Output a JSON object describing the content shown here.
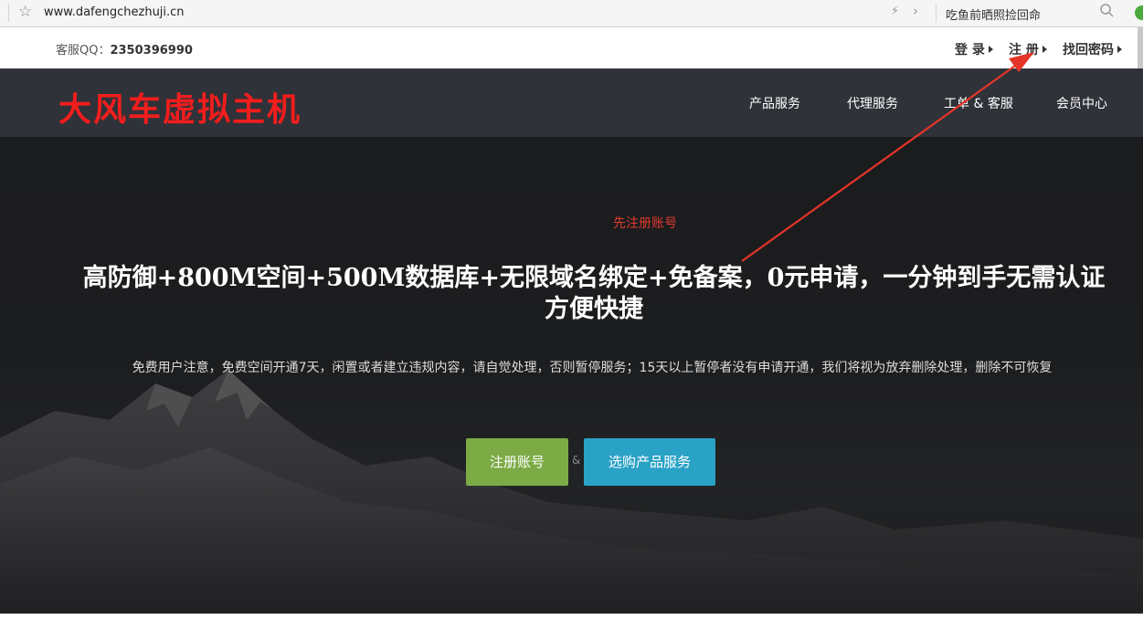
{
  "browser": {
    "url": "www.dafengchezhuji.cn",
    "search_text": "吃鱼前晒照捡回命"
  },
  "topbar": {
    "qq_label": "客服QQ：",
    "qq_number": "2350396990",
    "links": [
      {
        "label": "登 录"
      },
      {
        "label": "注 册"
      },
      {
        "label": "找回密码"
      }
    ]
  },
  "nav": {
    "logo": "大风车虚拟主机",
    "items": [
      {
        "label": "产品服务"
      },
      {
        "label": "代理服务"
      },
      {
        "label": "工单 & 客服"
      },
      {
        "label": "会员中心"
      }
    ]
  },
  "hero": {
    "hint": "先注册账号",
    "headline": "高防御+800M空间+500M数据库+无限域名绑定+免备案，0元申请，一分钟到手无需认证方便快捷",
    "notice": "免费用户注意，免费空间开通7天，闲置或者建立违规内容，请自觉处理，否则暂停服务；15天以上暂停者没有申请开通，我们将视为放弃删除处理，删除不可恢复",
    "btn_register": "注册账号",
    "amp": "&",
    "btn_buy": "选购产品服务"
  },
  "colors": {
    "logo": "#f21d1d",
    "navbar_bg": "#2f3238",
    "register_btn": "#7cab46",
    "buy_btn": "#2aa2c6",
    "annotation": "#e53428"
  },
  "icons": [
    "star-icon",
    "bolt-icon",
    "chevron-right-icon",
    "search-icon",
    "caret-right-icon",
    "arrow-annotation"
  ]
}
